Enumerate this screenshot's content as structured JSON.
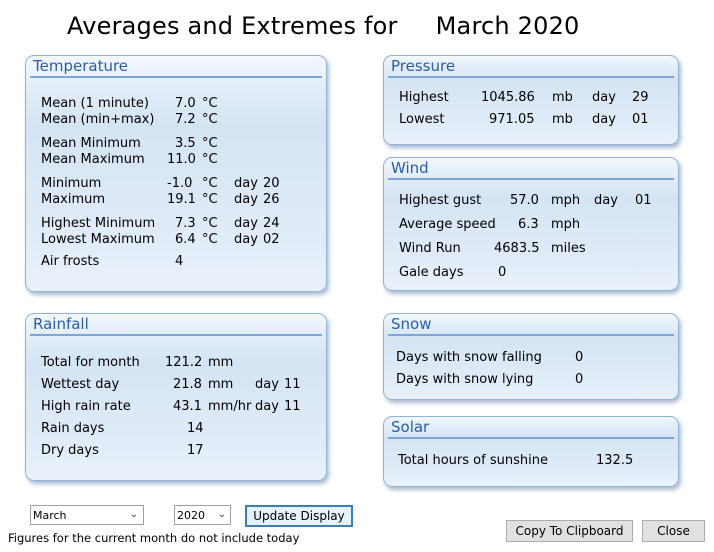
{
  "title": {
    "prefix": "Averages and Extremes for",
    "period": "March 2020"
  },
  "temperature": {
    "title": "Temperature",
    "rows": [
      {
        "label": "Mean (1 minute)",
        "value": "7.0",
        "unit": "°C",
        "day_label": "",
        "day": ""
      },
      {
        "label": "Mean (min+max)",
        "value": "7.2",
        "unit": "°C",
        "day_label": "",
        "day": ""
      },
      {
        "label": "Mean Minimum",
        "value": "3.5",
        "unit": "°C",
        "day_label": "",
        "day": ""
      },
      {
        "label": "Mean Maximum",
        "value": "11.0",
        "unit": "°C",
        "day_label": "",
        "day": ""
      },
      {
        "label": "Minimum",
        "value": "-1.0",
        "unit": "°C",
        "day_label": "day",
        "day": "20"
      },
      {
        "label": "Maximum",
        "value": "19.1",
        "unit": "°C",
        "day_label": "day",
        "day": "26"
      },
      {
        "label": "Highest Minimum",
        "value": "7.3",
        "unit": "°C",
        "day_label": "day",
        "day": "24"
      },
      {
        "label": "Lowest Maximum",
        "value": "6.4",
        "unit": "°C",
        "day_label": "day",
        "day": "02"
      },
      {
        "label": "Air frosts",
        "value": "4",
        "unit": "",
        "day_label": "",
        "day": ""
      }
    ]
  },
  "rainfall": {
    "title": "Rainfall",
    "rows": [
      {
        "label": "Total for month",
        "value": "121.2",
        "unit": "mm",
        "day_label": "",
        "day": ""
      },
      {
        "label": "Wettest day",
        "value": "21.8",
        "unit": "mm",
        "day_label": "day",
        "day": "11"
      },
      {
        "label": "High rain rate",
        "value": "43.1",
        "unit": "mm/hr",
        "day_label": "day",
        "day": "11"
      },
      {
        "label": "Rain days",
        "value": "14",
        "unit": "",
        "day_label": "",
        "day": ""
      },
      {
        "label": "Dry days",
        "value": "17",
        "unit": "",
        "day_label": "",
        "day": ""
      }
    ]
  },
  "pressure": {
    "title": "Pressure",
    "rows": [
      {
        "label": "Highest",
        "value": "1045.86",
        "unit": "mb",
        "day_label": "day",
        "day": "29"
      },
      {
        "label": "Lowest",
        "value": "971.05",
        "unit": "mb",
        "day_label": "day",
        "day": "01"
      }
    ]
  },
  "wind": {
    "title": "Wind",
    "rows": [
      {
        "label": "Highest gust",
        "value": "57.0",
        "unit": "mph",
        "day_label": "day",
        "day": "01"
      },
      {
        "label": "Average speed",
        "value": "6.3",
        "unit": "mph",
        "day_label": "",
        "day": ""
      },
      {
        "label": "Wind Run",
        "value": "4683.5",
        "unit": "miles",
        "day_label": "",
        "day": ""
      },
      {
        "label": "Gale days",
        "value": "0",
        "unit": "",
        "day_label": "",
        "day": ""
      }
    ]
  },
  "snow": {
    "title": "Snow",
    "rows": [
      {
        "label": "Days with snow falling",
        "value": "0"
      },
      {
        "label": "Days with snow lying",
        "value": "0"
      }
    ]
  },
  "solar": {
    "title": "Solar",
    "rows": [
      {
        "label": "Total hours of sunshine",
        "value": "132.5"
      }
    ]
  },
  "controls": {
    "month_selected": "March",
    "year_selected": "2020",
    "update_label": "Update Display",
    "copy_label": "Copy To Clipboard",
    "close_label": "Close",
    "dropdown_icon": "chevron-down-icon"
  },
  "footnote": "Figures for the current month do not include today"
}
